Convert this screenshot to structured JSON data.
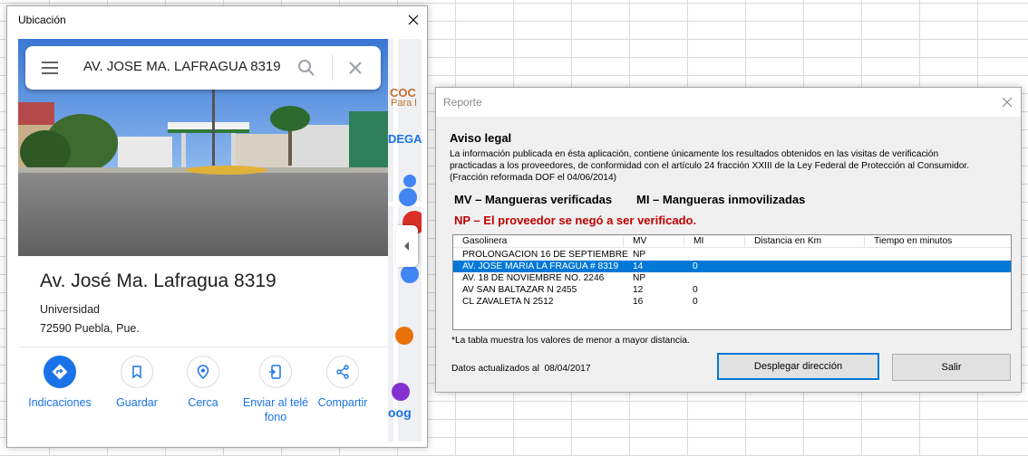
{
  "ubicacion_window": {
    "title": "Ubicación",
    "search": {
      "query": "AV. JOSE MA. LAFRAGUA 8319"
    },
    "map_strip_labels": {
      "coc": "COC",
      "para": "Para l",
      "dega": "DEGA",
      "goog": "oog"
    },
    "place": {
      "title": "Av. José Ma. Lafragua 8319",
      "line1": "Universidad",
      "line2": "72590 Puebla, Pue."
    },
    "actions": [
      {
        "label": "Indicaciones",
        "icon": "directions-icon"
      },
      {
        "label": "Guardar",
        "icon": "bookmark-icon"
      },
      {
        "label": "Cerca",
        "icon": "nearby-icon"
      },
      {
        "label_line1": "Enviar al telé",
        "label_line2": "fono",
        "icon": "send-to-phone-icon"
      },
      {
        "label": "Compartir",
        "icon": "share-icon"
      }
    ]
  },
  "reporte_window": {
    "title": "Reporte",
    "legal_heading": "Aviso legal",
    "legal_lines": [
      "La información publicada en ésta aplicación, contiene únicamente los resultados obtenidos en las visitas de verificación",
      "practicadas a los proveedores, de conformidad con el artículo 24 fracción XXIII de la Ley Federal de Protección al Consumidor.",
      "(Fracción reformada DOF el 04/06/2014)"
    ],
    "legend_mv": "MV – Mangueras verificadas",
    "legend_mi": "MI – Mangueras inmovilizadas",
    "legend_np": "NP – El proveedor se negó a ser verificado.",
    "table": {
      "columns": [
        "Gasolinera",
        "MV",
        "MI",
        "Distancia en Km",
        "Tiempo en minutos"
      ],
      "rows": [
        {
          "gasolinera": "PROLONGACION 16 DE SEPTIEMBRE",
          "mv": "NP",
          "mi": "",
          "selected": false
        },
        {
          "gasolinera": "AV. JOSE MARIA LA FRAGUA # 8319",
          "mv": "14",
          "mi": "0",
          "selected": true
        },
        {
          "gasolinera": "AV. 18 DE NOVIEMBRE NO. 2246",
          "mv": "NP",
          "mi": "",
          "selected": false
        },
        {
          "gasolinera": "AV SAN BALTAZAR N 2455",
          "mv": "12",
          "mi": "0",
          "selected": false
        },
        {
          "gasolinera": "CL ZAVALETA N 2512",
          "mv": "16",
          "mi": "0",
          "selected": false
        }
      ]
    },
    "table_note": "*La tabla muestra los valores de menor a mayor distancia.",
    "data_updated_label": "Datos actualizados al",
    "data_updated_date": "08/04/2017",
    "buttons": {
      "desplegar": "Desplegar dirección",
      "salir": "Salir"
    }
  },
  "colors": {
    "google_blue": "#1a73e8",
    "selection_blue": "#0078d7",
    "np_red": "#c00000",
    "dialog_bg": "#f0f0f0"
  }
}
